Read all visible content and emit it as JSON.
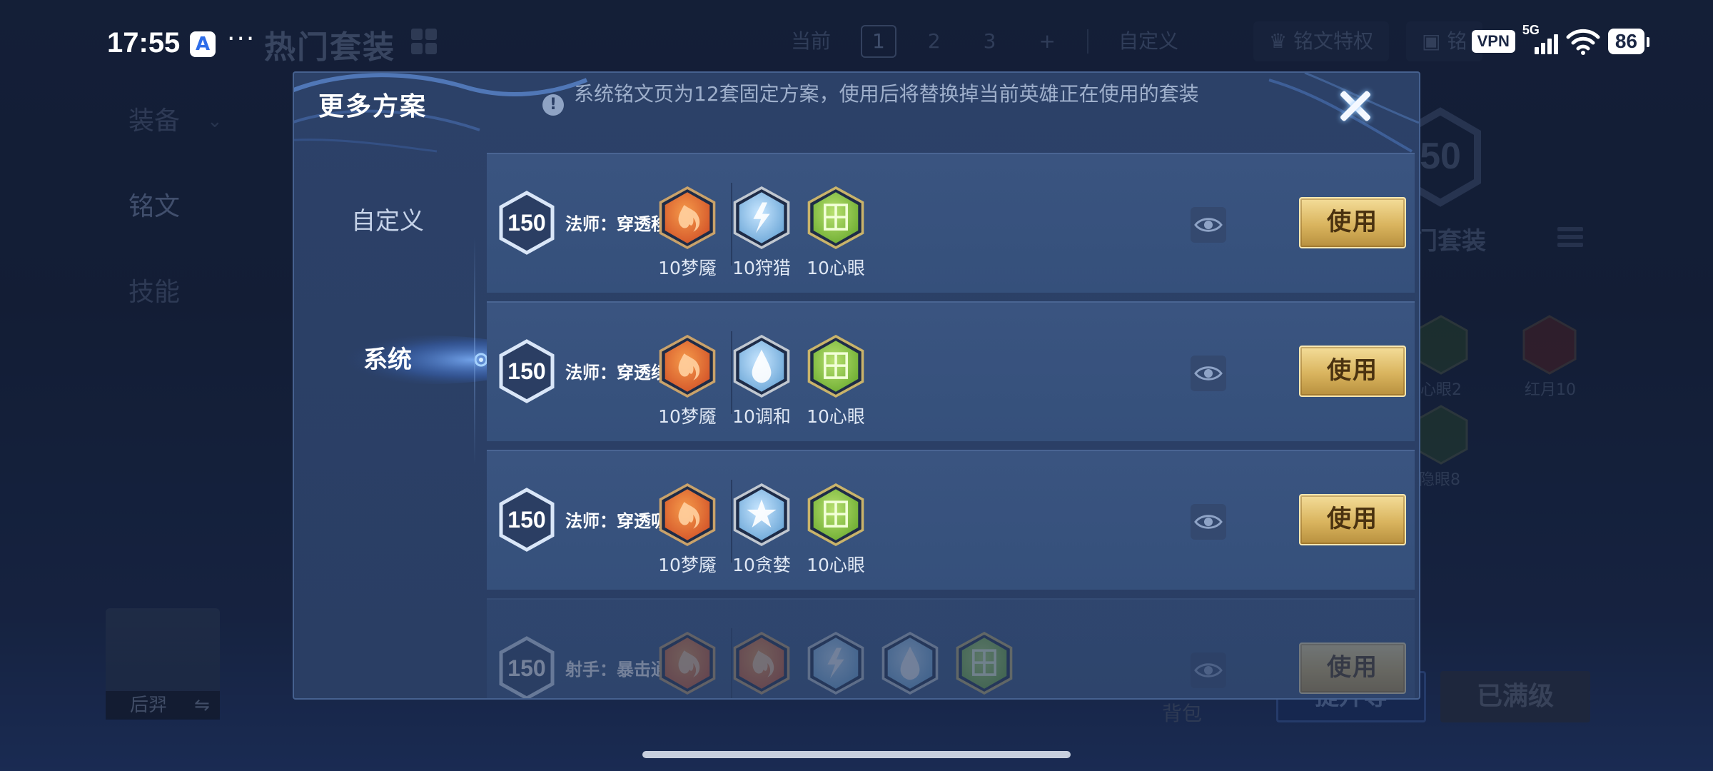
{
  "status_bar": {
    "time": "17:55",
    "app_badge": "A",
    "dots": "···",
    "vpn": "VPN",
    "network": "5G",
    "battery": "86"
  },
  "background": {
    "title": "热门套装",
    "tabs": [
      "当前",
      "1",
      "2",
      "3",
      "+",
      "自定义"
    ],
    "pills": [
      "铭文特权",
      "铭"
    ],
    "left_menu": [
      "装备",
      "铭文",
      "技能"
    ],
    "hero_name": "后羿",
    "hero_swap": "⇋",
    "right_level": "50",
    "right_title": "门套装",
    "right_runes": [
      "心眼2",
      "红月10",
      "隐眼8"
    ],
    "bag": "背包",
    "btn_upgrade": "提升等",
    "btn_max": "已满级"
  },
  "modal": {
    "title": "更多方案",
    "notice": "系统铭文页为12套固定方案，使用后将替换掉当前英雄正在使用的套装",
    "info_icon": "!",
    "side_tabs": [
      {
        "label": "自定义",
        "active": false
      },
      {
        "label": "系统",
        "active": true
      }
    ],
    "use_label": "使用",
    "rows": [
      {
        "level": "150",
        "name": "法师：穿透移速",
        "runes": [
          {
            "label": "10梦魇",
            "color": "red",
            "icon": "flame-rune-icon"
          },
          {
            "label": "10狩猎",
            "color": "blue",
            "icon": "lightning-rune-icon"
          },
          {
            "label": "10心眼",
            "color": "green",
            "icon": "leaf-rune-icon"
          }
        ]
      },
      {
        "level": "150",
        "name": "法师：穿透续航",
        "runes": [
          {
            "label": "10梦魇",
            "color": "red",
            "icon": "flame-rune-icon"
          },
          {
            "label": "10调和",
            "color": "blue",
            "icon": "drop-rune-icon"
          },
          {
            "label": "10心眼",
            "color": "green",
            "icon": "leaf-rune-icon"
          }
        ]
      },
      {
        "level": "150",
        "name": "法师：穿透吸血",
        "runes": [
          {
            "label": "10梦魇",
            "color": "red",
            "icon": "flame-rune-icon"
          },
          {
            "label": "10贪婪",
            "color": "blue",
            "icon": "star-rune-icon"
          },
          {
            "label": "10心眼",
            "color": "green",
            "icon": "leaf-rune-icon"
          }
        ]
      },
      {
        "level": "150",
        "name": "射手：暴击通用",
        "runes": [
          {
            "label": "",
            "color": "red",
            "icon": "flame-rune-icon"
          },
          {
            "label": "",
            "color": "red",
            "icon": "flame-rune-icon"
          },
          {
            "label": "",
            "color": "blue",
            "icon": "lightning-rune-icon"
          },
          {
            "label": "",
            "color": "blue",
            "icon": "drop-rune-icon"
          },
          {
            "label": "",
            "color": "green",
            "icon": "leaf-rune-icon"
          }
        ]
      }
    ]
  },
  "colors": {
    "red_rune": "#d9582a",
    "blue_rune": "#7fb8e6",
    "green_rune": "#7dbb3a",
    "gold_button": "#d9b45e"
  }
}
